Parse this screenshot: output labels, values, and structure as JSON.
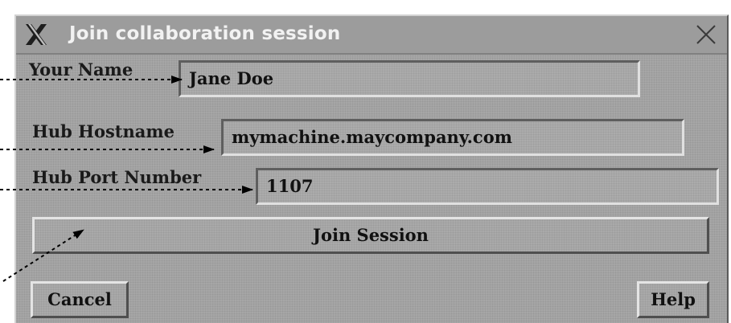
{
  "window": {
    "title": "Join collaboration session"
  },
  "form": {
    "name_label": "Your Name",
    "name_value": "Jane Doe",
    "host_label": "Hub Hostname",
    "host_value": "mymachine.maycompany.com",
    "port_label": "Hub Port Number",
    "port_value": "1107"
  },
  "buttons": {
    "join": "Join Session",
    "cancel": "Cancel",
    "help": "Help"
  },
  "icons": {
    "logo": "x-window-logo-icon",
    "close": "close-icon"
  },
  "colors": {
    "dialog_bg": "#a6a6a6",
    "title_text": "#f2f2f2"
  }
}
